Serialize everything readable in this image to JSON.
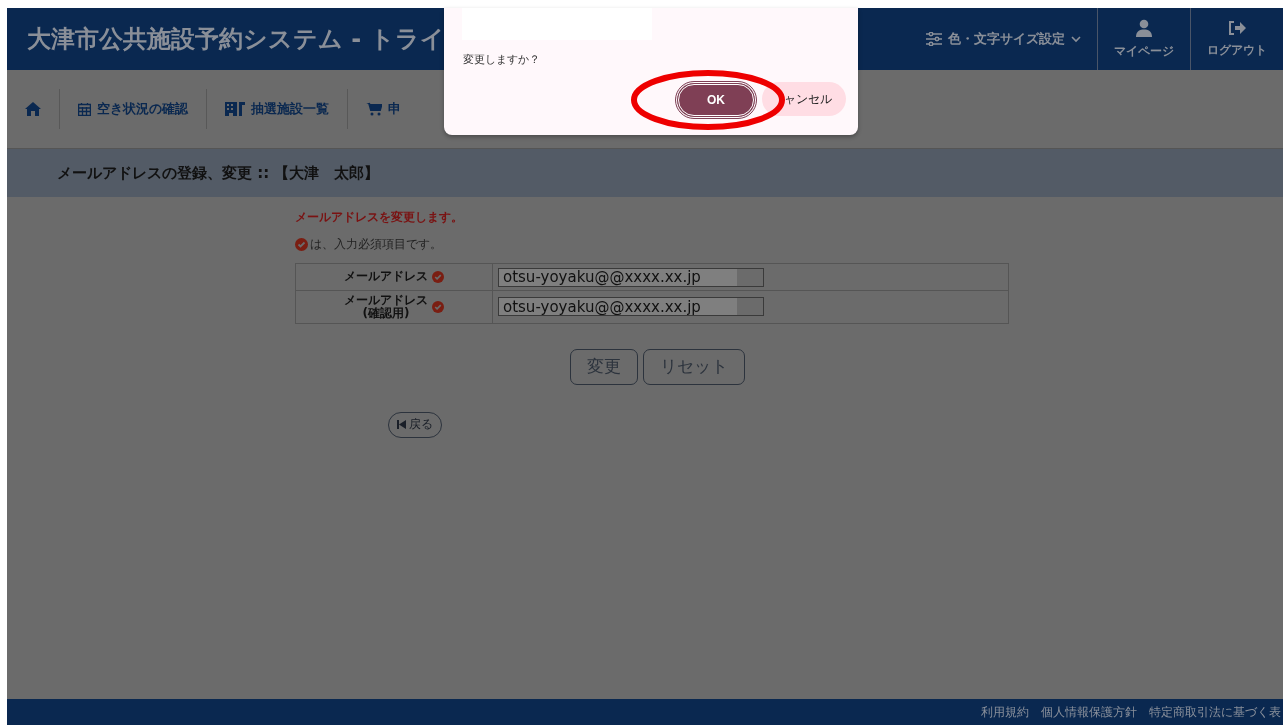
{
  "header": {
    "title": "大津市公共施設予約システム - トライ",
    "settings_label": "色・文字サイズ設定",
    "user_menu": [
      {
        "kind": "user",
        "label": "マイページ"
      },
      {
        "kind": "logout",
        "label": "ログアウト"
      }
    ]
  },
  "nav": {
    "items": [
      {
        "kind": "home"
      },
      {
        "kind": "calendar",
        "label": "空き状況の確認"
      },
      {
        "kind": "building",
        "label": "抽選施設一覧"
      },
      {
        "kind": "cart",
        "label": "申"
      }
    ]
  },
  "page_title": "メールアドレスの登録、変更 :: 【大津　太郎】",
  "notice": "メールアドレスを変更します。",
  "required_note": "は、入力必須項目です。",
  "form": {
    "rows": [
      {
        "label": "メールアドレス",
        "value": "otsu-yoyaku@@xxxx.xx.jp"
      },
      {
        "label": "メールアドレス",
        "sublabel": "(確認用)",
        "value": "otsu-yoyaku@@xxxx.xx.jp"
      }
    ]
  },
  "buttons": [
    "変更",
    "リセット"
  ],
  "back_button": "戻る",
  "footer": {
    "links": [
      "利用規約",
      "個人情報保護方針",
      "特定商取引法に基づく表"
    ]
  },
  "dialog": {
    "message": "変更しますか？",
    "ok": "OK",
    "cancel": "ャンセル"
  }
}
